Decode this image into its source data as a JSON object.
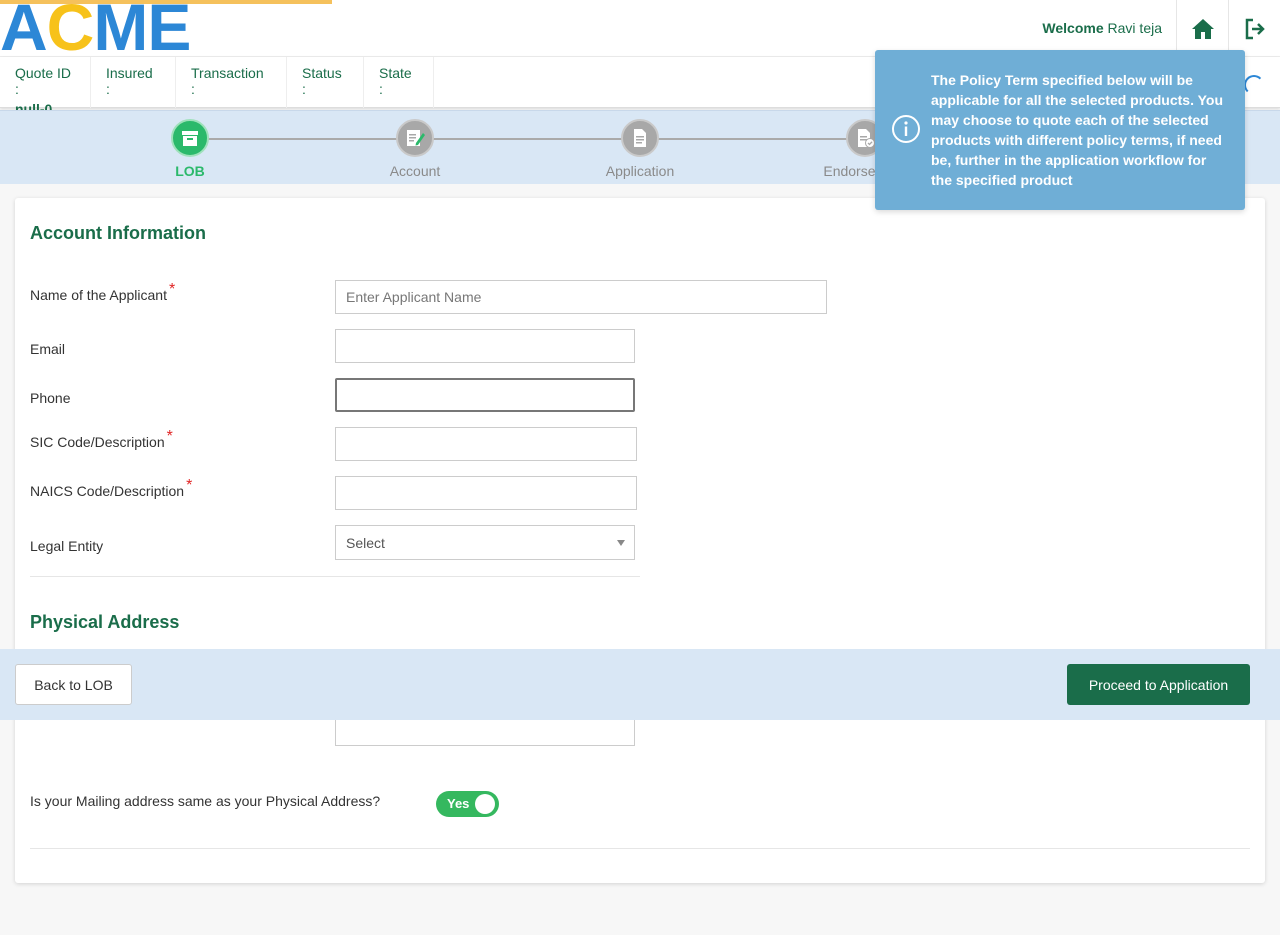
{
  "header": {
    "logo": {
      "a": "A",
      "c": "C",
      "me": "ME"
    },
    "welcome_label": "Welcome",
    "user_name": "Ravi teja"
  },
  "quote_bar": {
    "quote_id_label": "Quote ID :",
    "quote_id_value": "null-0",
    "insured_label": "Insured :",
    "transaction_label": "Transaction :",
    "status_label": "Status :",
    "state_label": "State :"
  },
  "stepper": {
    "steps": [
      {
        "label": "LOB"
      },
      {
        "label": "Account"
      },
      {
        "label": "Application"
      },
      {
        "label": "Endorsement"
      }
    ]
  },
  "tooltip": {
    "text": "The Policy Term specified below will be applicable for all the selected products. You may choose to quote each of the selected products with different policy terms, if need be, further in the application workflow for the specified product"
  },
  "account_info": {
    "title": "Account Information",
    "applicant_label": "Name of the Applicant",
    "applicant_placeholder": "Enter Applicant Name",
    "email_label": "Email",
    "phone_label": "Phone",
    "sic_label": "SIC Code/Description",
    "naics_label": "NAICS Code/Description",
    "legal_entity_label": "Legal Entity",
    "legal_entity_value": "Select",
    "required_mark": "*"
  },
  "physical_address": {
    "title": "Physical Address",
    "mailing_question": "Is your Mailing address same as your Physical Address?",
    "toggle_label": "Yes"
  },
  "actions": {
    "back_label": "Back to LOB",
    "proceed_label": "Proceed to Application"
  },
  "colors": {
    "brand_green": "#1a6d4a",
    "active_step": "#2bb96b",
    "logo_blue": "#2c87d6",
    "logo_yellow": "#f7c21a",
    "tooltip_bg": "#6faed6"
  }
}
